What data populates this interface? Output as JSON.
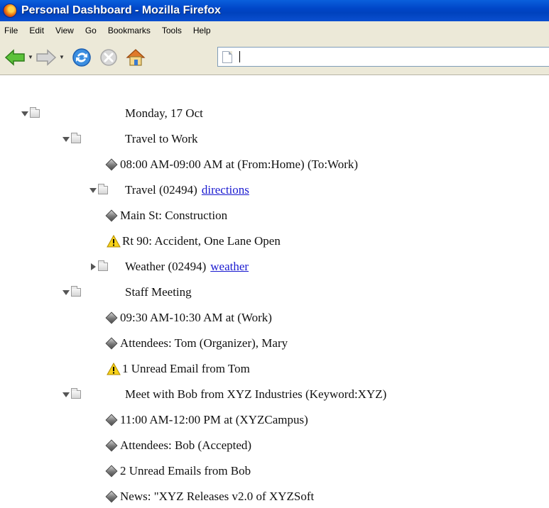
{
  "window": {
    "title": "Personal Dashboard - Mozilla Firefox"
  },
  "menu": [
    "File",
    "Edit",
    "View",
    "Go",
    "Bookmarks",
    "Tools",
    "Help"
  ],
  "toolbar": {
    "back": "back-arrow-icon",
    "forward": "forward-arrow-icon",
    "reload": "reload-icon",
    "stop": "stop-icon",
    "home": "home-icon",
    "url_value": ""
  },
  "tree": {
    "date": "Monday, 17 Oct",
    "travel_group": "Travel to Work",
    "travel_time": "08:00 AM-09:00 AM at (From:Home) (To:Work)",
    "travel_node": "Travel (02494)",
    "travel_link": "directions",
    "travel_item1": "Main St: Construction",
    "travel_item2": "Rt 90: Accident, One Lane Open",
    "weather_node": "Weather (02494)",
    "weather_link": "weather",
    "staff_group": "Staff Meeting",
    "staff_time": "09:30 AM-10:30 AM at (Work)",
    "staff_attendees": "Attendees: Tom (Organizer), Mary",
    "staff_email": "1 Unread Email from Tom",
    "bob_group": "Meet with Bob from XYZ Industries (Keyword:XYZ)",
    "bob_time": "11:00 AM-12:00 PM at (XYZCampus)",
    "bob_attendees": "Attendees: Bob (Accepted)",
    "bob_email": "2 Unread Emails from Bob",
    "bob_news": "News: \"XYZ Releases v2.0 of XYZSoft"
  }
}
